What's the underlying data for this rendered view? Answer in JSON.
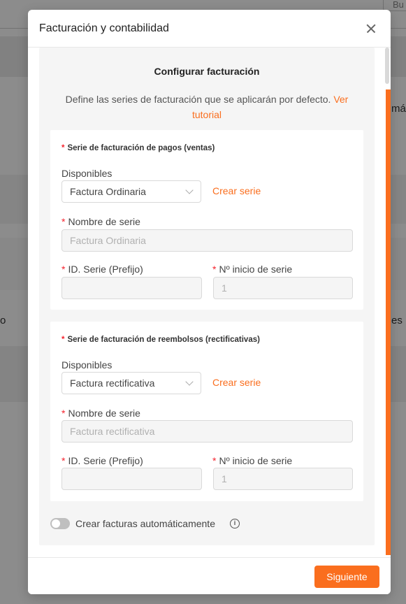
{
  "background": {
    "search_fragment": "Bu",
    "text_right_1": "máti",
    "text_left": "o",
    "text_right_2": "es"
  },
  "modal": {
    "title": "Facturación y contabilidad",
    "section_title": "Configurar facturación",
    "description": "Define las series de facturación que se aplicarán por defecto.",
    "tutorial_link": "Ver tutorial",
    "card_payments": {
      "heading": "Serie de facturación de pagos (ventas)",
      "available_label": "Disponibles",
      "available_value": "Factura Ordinaria",
      "create_series": "Crear serie",
      "series_name_label": "Nombre de serie",
      "series_name_placeholder": "Factura Ordinaria",
      "series_id_label": "ID. Serie (Prefijo)",
      "series_id_value": "",
      "start_number_label": "Nº inicio de serie",
      "start_number_placeholder": "1"
    },
    "card_refunds": {
      "heading": "Serie de facturación de reembolsos (rectificativas)",
      "available_label": "Disponibles",
      "available_value": "Factura rectificativa",
      "create_series": "Crear serie",
      "series_name_label": "Nombre de serie",
      "series_name_placeholder": "Factura rectificativa",
      "series_id_label": "ID. Serie (Prefijo)",
      "series_id_value": "",
      "start_number_label": "Nº inicio de serie",
      "start_number_placeholder": "1"
    },
    "auto_invoices_label": "Crear facturas automáticamente",
    "auto_invoices_enabled": false,
    "info_icon": "info-icon",
    "next_button": "Siguiente"
  },
  "colors": {
    "accent": "#fa6e1e",
    "required": "#f5222d"
  }
}
